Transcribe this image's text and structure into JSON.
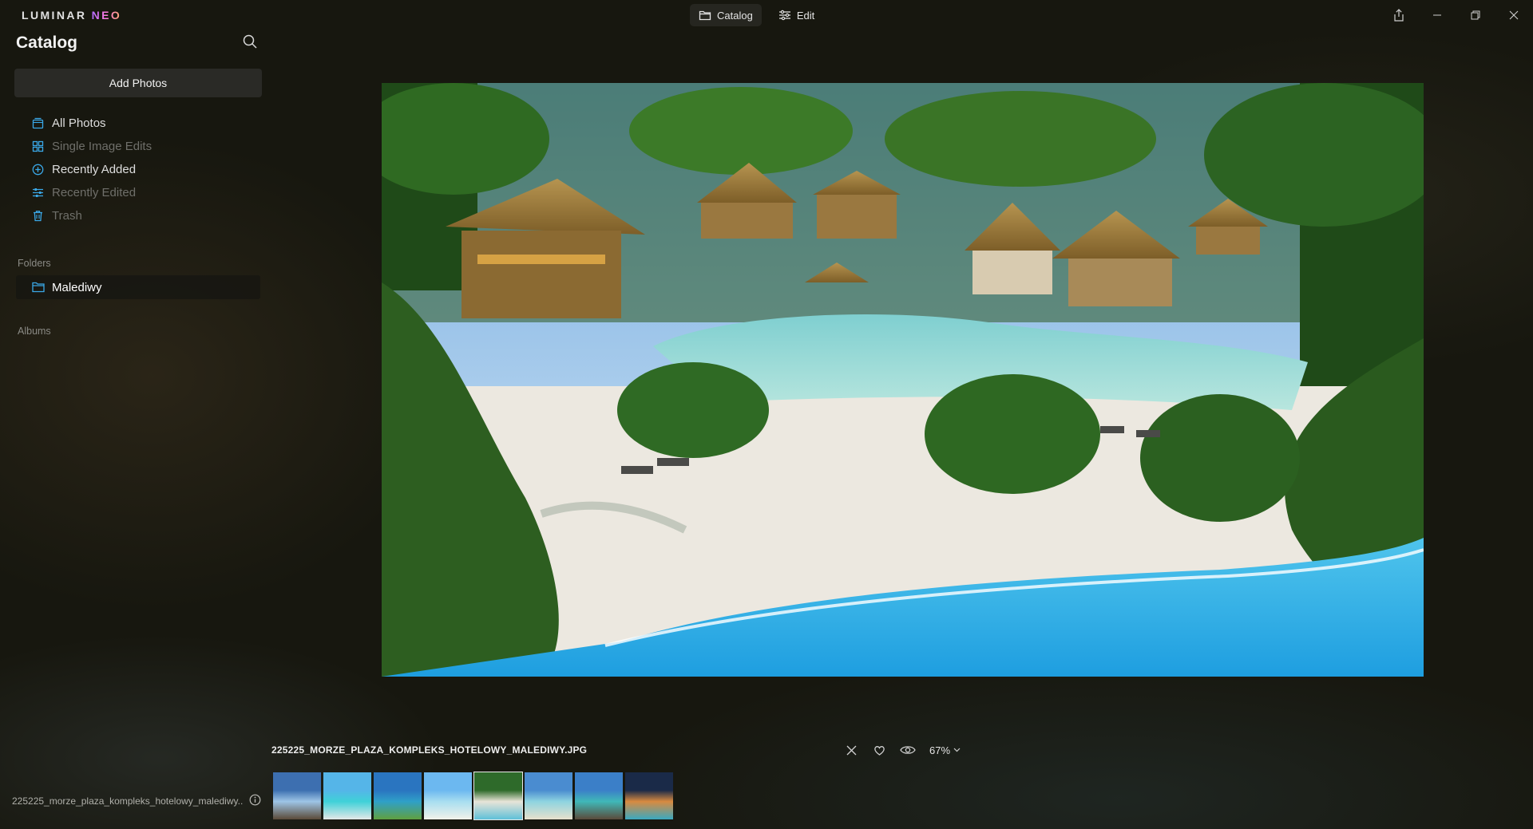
{
  "app": {
    "logo_main": "LUMINAR ",
    "logo_accent": "NEO"
  },
  "modes": [
    {
      "label": "Catalog",
      "icon": "folder-icon",
      "active": true
    },
    {
      "label": "Edit",
      "icon": "sliders-icon",
      "active": false
    }
  ],
  "window_controls": [
    "share-icon",
    "minimize-icon",
    "restore-icon",
    "close-icon"
  ],
  "sidebar": {
    "title": "Catalog",
    "add_photos": "Add Photos",
    "nav": [
      {
        "label": "All Photos",
        "icon": "photos-icon",
        "dim": false
      },
      {
        "label": "Single Image Edits",
        "icon": "grid-icon",
        "dim": true
      },
      {
        "label": "Recently Added",
        "icon": "plus-circle-icon",
        "dim": false
      },
      {
        "label": "Recently Edited",
        "icon": "sliders-icon",
        "dim": true
      },
      {
        "label": "Trash",
        "icon": "trash-icon",
        "dim": true
      }
    ],
    "folders_label": "Folders",
    "folder": "Malediwy",
    "albums_label": "Albums",
    "bottom_filename": "225225_morze_plaza_kompleks_hotelowy_malediwy...."
  },
  "viewer": {
    "filename": "225225_MORZE_PLAZA_KOMPLEKS_HOTELOWY_MALEDIWY.JPG",
    "zoom": "67%"
  },
  "thumbnails": [
    {
      "colors": [
        "#3d6fb0",
        "#9ec5e6",
        "#5a4a38"
      ],
      "selected": false
    },
    {
      "colors": [
        "#55b5e8",
        "#3fd1d8",
        "#e4e8e8"
      ],
      "selected": false
    },
    {
      "colors": [
        "#2a75c0",
        "#2fa0c8",
        "#60a040"
      ],
      "selected": false
    },
    {
      "colors": [
        "#6cb8f0",
        "#a8def0",
        "#f2f2ea"
      ],
      "selected": false
    },
    {
      "colors": [
        "#2e6a2a",
        "#e8e4d8",
        "#5fc0d8"
      ],
      "selected": true
    },
    {
      "colors": [
        "#4a8cd0",
        "#8ed4e0",
        "#e8e0cc"
      ],
      "selected": false
    },
    {
      "colors": [
        "#3b7fc8",
        "#40b8b8",
        "#5a4a3a"
      ],
      "selected": false
    },
    {
      "colors": [
        "#1a2a48",
        "#d88a40",
        "#3aa8c0"
      ],
      "selected": false
    }
  ],
  "colors": {
    "accent_blue": "#3aa8e8",
    "background": "#17170f"
  }
}
